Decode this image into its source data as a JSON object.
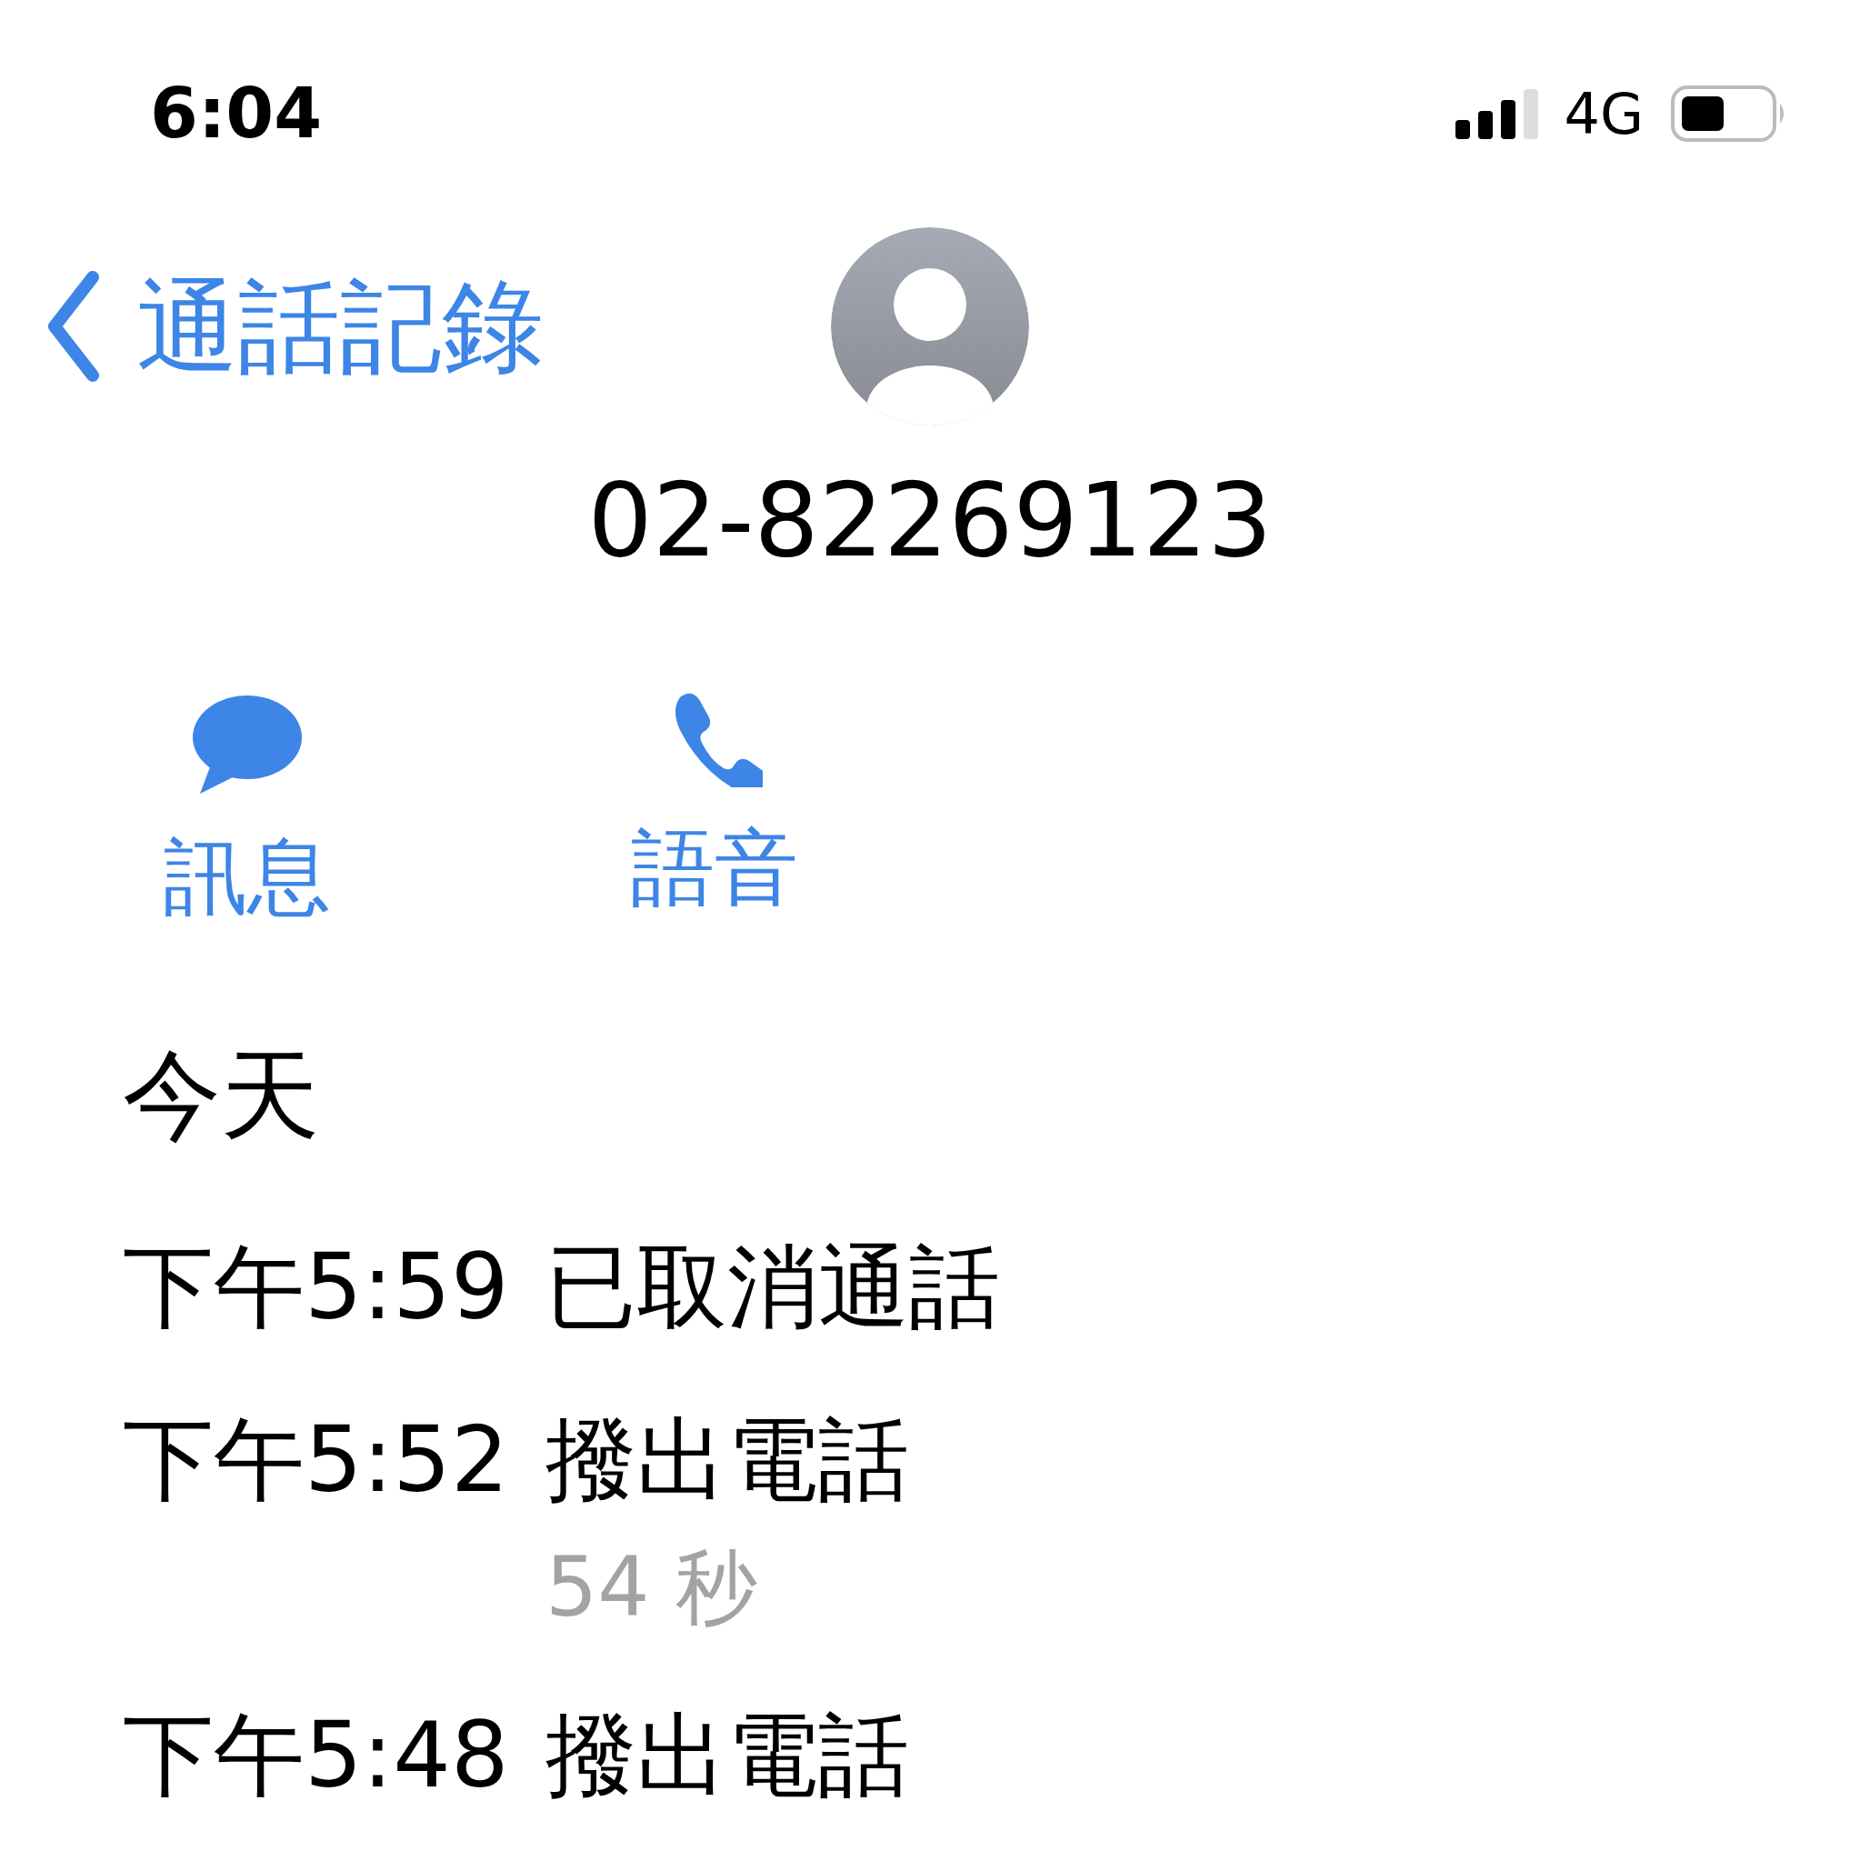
{
  "status_bar": {
    "time": "6:04",
    "network": "4G"
  },
  "nav": {
    "back_label": "通話記錄"
  },
  "contact": {
    "number": "02-82269123"
  },
  "actions": [
    {
      "kind": "message",
      "label": "訊息"
    },
    {
      "kind": "voice",
      "label": "語音"
    }
  ],
  "section": "今天",
  "calls": [
    {
      "time": "下午5:59",
      "type": "已取消通話"
    },
    {
      "time": "下午5:52",
      "type": "撥出電話",
      "duration": "54 秒"
    },
    {
      "time": "下午5:48",
      "type": "撥出電話"
    }
  ]
}
